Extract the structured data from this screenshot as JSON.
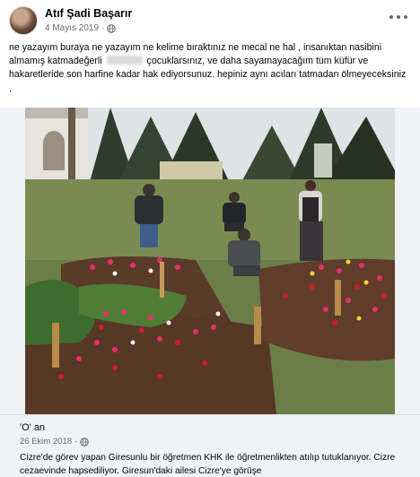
{
  "post": {
    "author": "Atıf Şadi Başarır",
    "date": "4 Mayıs 2019",
    "dot": "·",
    "text_part1": "ne yazayım buraya ne yazayım ne kelime bıraktınız ne mecal ne hal , insanıktan nasibini almamış katmadeğerli",
    "text_part2": "çocuklarsınız, ve daha sayamayacağım tüm küfür ve hakaretleride son harfine kadar hak ediyorsunuz. hepiniz aynı acıları tatmadan ölmeyeceksiniz ."
  },
  "icons": {
    "avatar": "profile-photo",
    "more": "more-options-icon",
    "globe": "globe-icon"
  },
  "shared_post": {
    "title": "'O' an",
    "date": "26 Ekim 2018",
    "dot": "·",
    "text": "Cizre'de görev yapan Giresunlu bir öğretmen KHK ile öğretmenlikten atılıp tutuklanıyor. Cizre cezaevinde hapsediliyor. Giresun'daki ailesi Cizre'ye görüşe"
  },
  "colors": {
    "background": "#ffffff",
    "secondary_text": "#65676b",
    "frame": "#f0f2f5"
  }
}
